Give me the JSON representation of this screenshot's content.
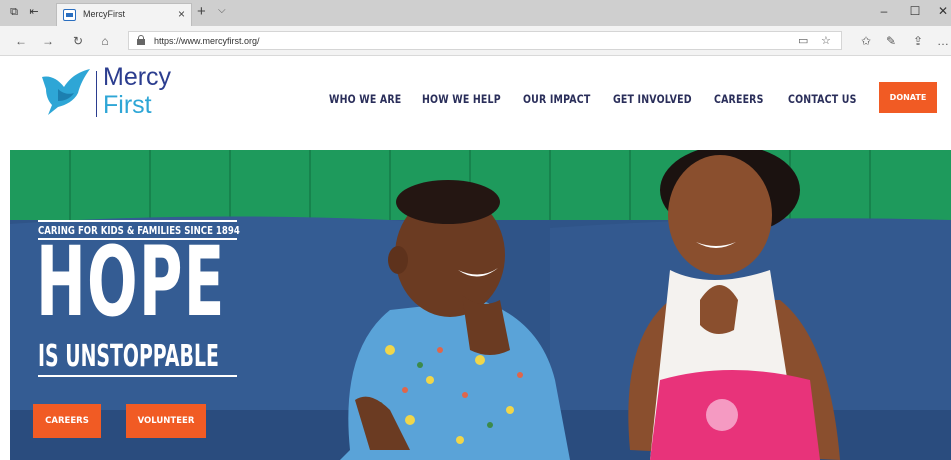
{
  "browser": {
    "tab_title": "MercyFirst",
    "url": "https://www.mercyfirst.org/",
    "new_tab_symbol": "+",
    "tab_close_symbol": "×"
  },
  "site": {
    "logo": {
      "line1": "Mercy",
      "line2": "First"
    },
    "nav": [
      {
        "label": "WHO WE ARE"
      },
      {
        "label": "HOW WE HELP"
      },
      {
        "label": "OUR IMPACT"
      },
      {
        "label": "GET INVOLVED"
      },
      {
        "label": "CAREERS"
      },
      {
        "label": "CONTACT US"
      }
    ],
    "donate_label": "DONATE"
  },
  "hero": {
    "tagline": "CARING FOR KIDS & FAMILIES SINCE 1894",
    "headline": "HOPE",
    "subheadline": "IS UNSTOPPABLE",
    "buttons": [
      {
        "label": "CAREERS"
      },
      {
        "label": "VOLUNTEER"
      }
    ]
  },
  "colors": {
    "brand_navy": "#2b3d8f",
    "brand_blue": "#2ea6d6",
    "accent_orange": "#f15b24",
    "nav_text": "#2a2e5a",
    "wall_green": "#1e9a5c",
    "sofa_blue": "#2f5488"
  },
  "icons": {
    "tab_bar": [
      "tab-actions-icon",
      "tab-aside-icon",
      "tab-chevron-icon"
    ],
    "nav_bar": [
      "back-icon",
      "forward-icon",
      "refresh-icon",
      "home-icon"
    ],
    "address_bar": [
      "lock-icon",
      "reading-view-icon",
      "favorite-star-icon"
    ],
    "toolbar": [
      "favorites-icon",
      "pen-icon",
      "share-icon",
      "more-icon"
    ],
    "window": [
      "minimize-icon",
      "maximize-icon",
      "close-icon"
    ]
  }
}
